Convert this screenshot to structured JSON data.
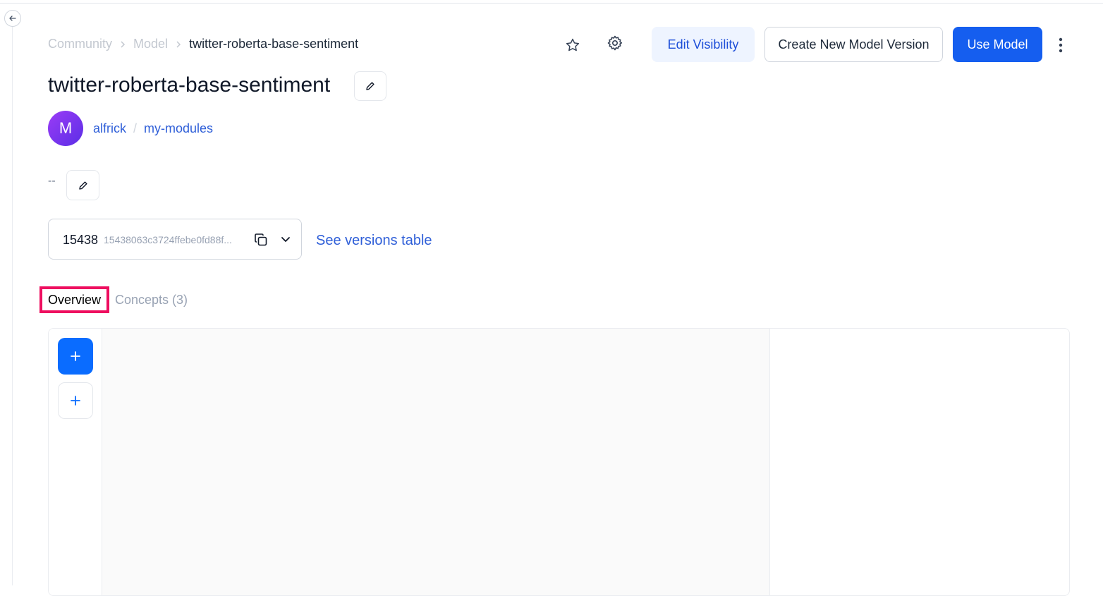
{
  "breadcrumb": {
    "items": [
      "Community",
      "Model"
    ],
    "current": "twitter-roberta-base-sentiment"
  },
  "header": {
    "edit_visibility_label": "Edit Visibility",
    "create_version_label": "Create New Model Version",
    "use_model_label": "Use Model"
  },
  "model": {
    "title": "twitter-roberta-base-sentiment",
    "avatar_initial": "M",
    "owner": "alfrick",
    "app": "my-modules",
    "description": "--"
  },
  "version": {
    "number": "15438",
    "hash": "15438063c3724ffebe0fd88f...",
    "see_versions_label": "See versions table"
  },
  "tabs": {
    "overview": "Overview",
    "concepts": "Concepts (3)"
  },
  "colors": {
    "primary": "#155eef",
    "accent_blue": "#0a6cff",
    "link": "#2f5fd8",
    "highlight": "#ee0e5f"
  },
  "icons": {
    "back": "arrow-left-icon",
    "star": "star-icon",
    "settings": "gear-icon",
    "more": "more-vertical-icon",
    "edit": "pencil-icon",
    "copy": "copy-icon",
    "dropdown": "chevron-down-icon",
    "add": "plus-icon"
  }
}
